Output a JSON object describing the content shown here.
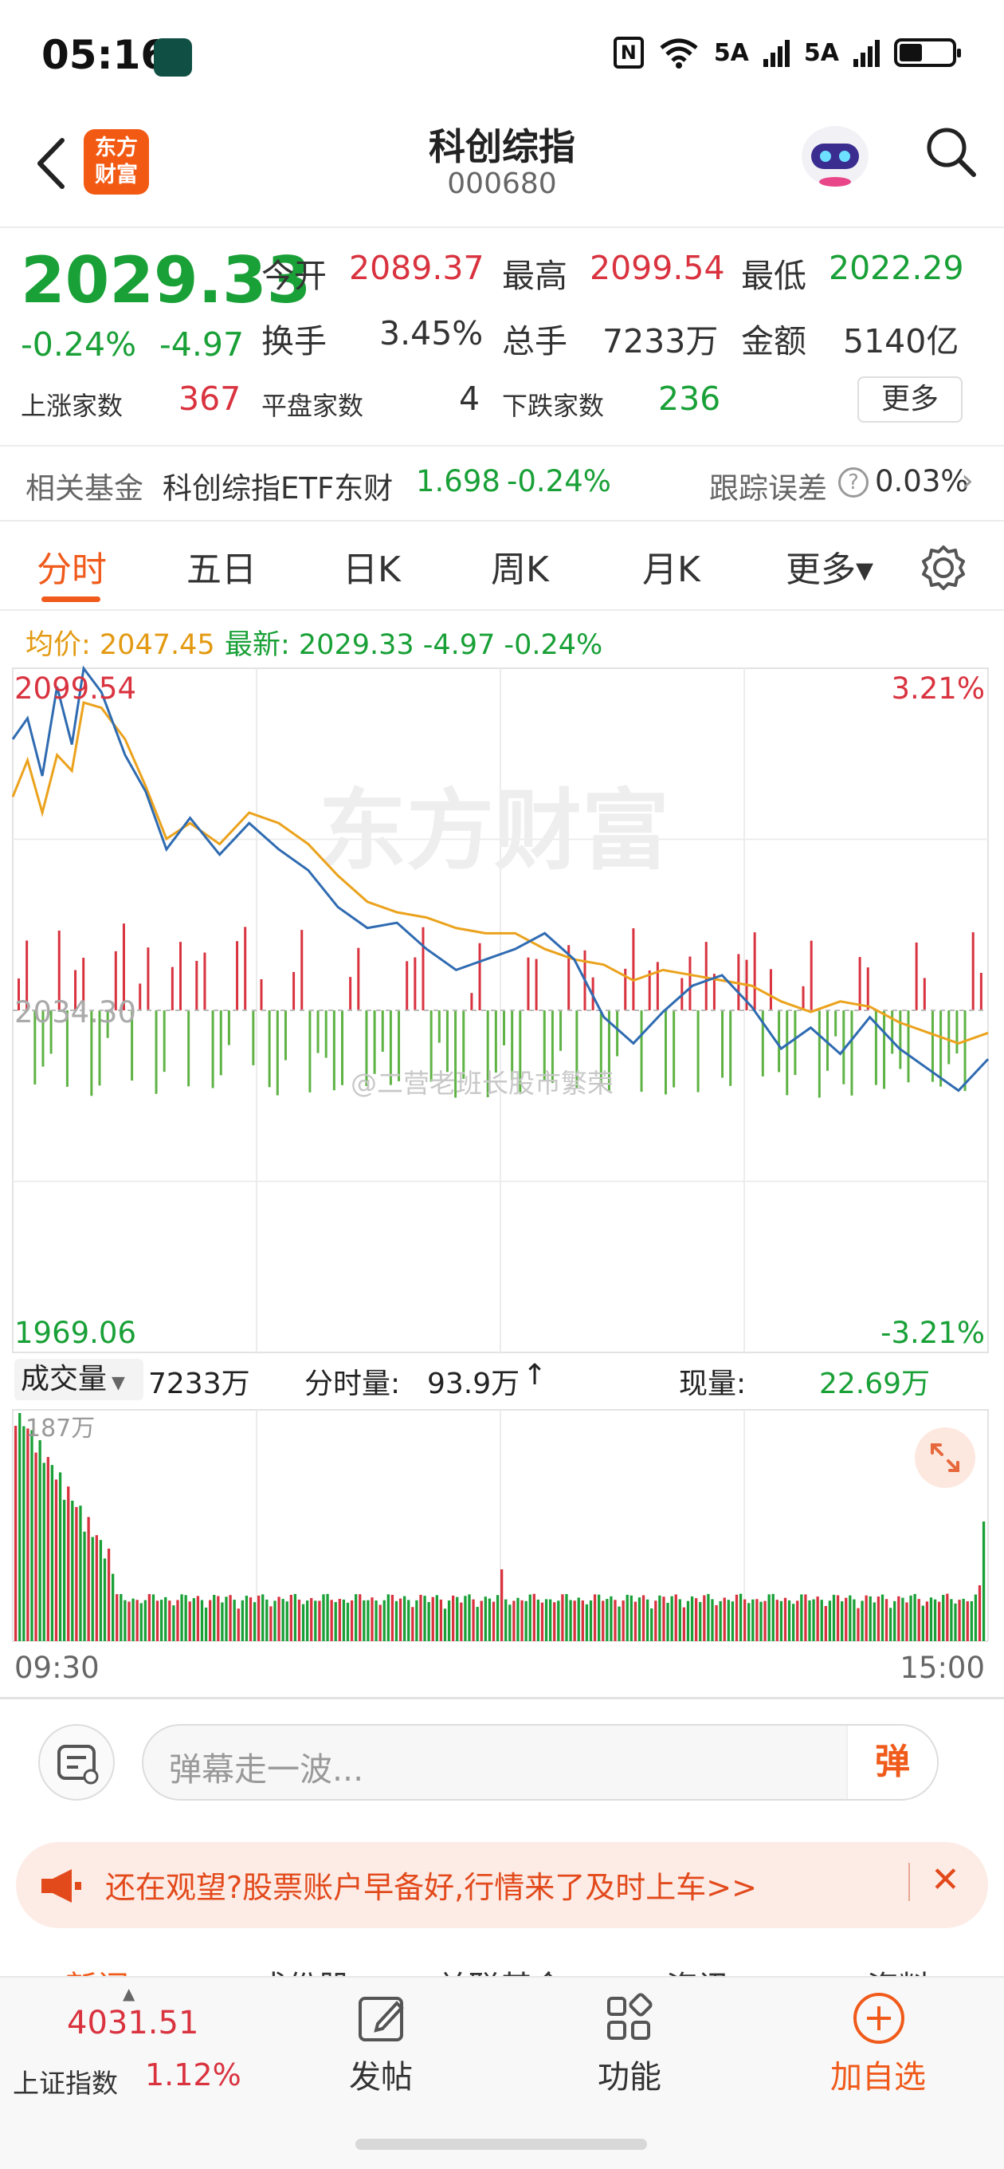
{
  "status_bar": {
    "time": "05:16",
    "net1": "5A",
    "net2": "5A"
  },
  "header": {
    "brand": "东方财富",
    "brand_line1": "东方",
    "brand_line2": "财富",
    "title": "科创综指",
    "code": "000680"
  },
  "quote": {
    "price": "2029.33",
    "change_pct": "-0.24%",
    "change": "-4.97",
    "open_label": "今开",
    "open": "2089.37",
    "high_label": "最高",
    "high": "2099.54",
    "low_label": "最低",
    "low": "2022.29",
    "turnover_label": "换手",
    "turnover": "3.45%",
    "volume_label": "总手",
    "volume": "7233万",
    "amount_label": "金额",
    "amount": "5140亿",
    "up_label": "上涨家数",
    "up": "367",
    "flat_label": "平盘家数",
    "flat": "4",
    "down_label": "下跌家数",
    "down": "236",
    "more": "更多"
  },
  "fund": {
    "label": "相关基金",
    "name": "科创综指ETF东财",
    "price": "1.698",
    "change": "-0.24%",
    "tracking_label": "跟踪误差",
    "tracking_value": "0.03%"
  },
  "tabs": [
    {
      "label": "分时",
      "active": true
    },
    {
      "label": "五日"
    },
    {
      "label": "日K"
    },
    {
      "label": "周K"
    },
    {
      "label": "月K"
    },
    {
      "label": "更多▾"
    }
  ],
  "chart_info": {
    "avg_label": "均价: 2047.45",
    "latest_label": "最新: 2029.33 -4.97 -0.24%"
  },
  "chart_labels": {
    "top_left": "2099.54",
    "top_right": "3.21%",
    "mid_left": "2034.30",
    "bottom_left": "1969.06",
    "bottom_right": "-3.21%",
    "vol_max": "187万",
    "time_start": "09:30",
    "time_end": "15:00",
    "watermark": "东方财富",
    "credit": "@二营老班长股市繁荣"
  },
  "volume_header": {
    "select": "成交量",
    "total": "7233万",
    "minute_label": "分时量:",
    "minute_value": "93.9万",
    "minute_arrow": "↑",
    "current_label": "现量:",
    "current_value": "22.69万"
  },
  "danmaku": {
    "placeholder": "弹幕走一波...",
    "send": "弹"
  },
  "promo": {
    "text": "还在观望?股票账户早备好,行情来了及时上车>>",
    "close": "✕"
  },
  "subtabs": [
    "新闻",
    "成份股",
    "关联基金",
    "资讯",
    "资料"
  ],
  "bottom_bar": {
    "index_value": "4031.51",
    "index_name": "上证指数",
    "index_change": "1.12%",
    "post": "发帖",
    "function": "功能",
    "add_watch": "加自选"
  },
  "colors": {
    "up": "#d9333f",
    "down": "#19a037",
    "price_line": "#2f6bb1",
    "avg_line": "#eba21c",
    "accent": "#f05a1a"
  },
  "chart_data": {
    "type": "line",
    "x_range": [
      "09:30",
      "15:00"
    ],
    "ylim": [
      1969.06,
      2099.54
    ],
    "reference": 2034.3,
    "pct_range": [
      "-3.21%",
      "3.21%"
    ],
    "series": [
      {
        "name": "最新",
        "color": "#2f6bb1",
        "x_min": [
          0,
          5,
          10,
          15,
          20,
          24,
          30,
          38,
          45,
          52,
          60,
          70,
          80,
          90,
          100,
          110,
          120,
          130,
          140,
          150,
          160,
          170,
          180,
          190,
          200,
          210,
          220,
          230,
          240,
          250,
          260,
          270,
          280,
          290,
          300,
          310,
          320,
          330
        ],
        "values": [
          2086,
          2090,
          2079,
          2096,
          2085,
          2099.5,
          2095,
          2083,
          2076,
          2065,
          2071,
          2064,
          2070,
          2065,
          2061,
          2054,
          2050,
          2051,
          2046,
          2042,
          2044,
          2046,
          2049,
          2044,
          2033,
          2028,
          2034,
          2039,
          2041,
          2035,
          2027,
          2031,
          2026,
          2033,
          2027,
          2023,
          2019,
          2025,
          2024
        ]
      },
      {
        "name": "均价",
        "color": "#eba21c",
        "x_min": [
          0,
          5,
          10,
          15,
          20,
          24,
          30,
          38,
          45,
          52,
          60,
          70,
          80,
          90,
          100,
          110,
          120,
          130,
          140,
          150,
          160,
          170,
          180,
          190,
          200,
          210,
          220,
          230,
          240,
          250,
          260,
          270,
          280,
          290,
          300,
          310,
          320,
          330
        ],
        "values": [
          2075,
          2082,
          2072,
          2083,
          2080,
          2093,
          2092,
          2086,
          2077,
          2067,
          2070,
          2066,
          2072,
          2070,
          2066,
          2060,
          2055,
          2053,
          2052,
          2050,
          2049,
          2049,
          2046,
          2044,
          2043,
          2040,
          2042,
          2041,
          2040,
          2039,
          2036,
          2034,
          2036,
          2035,
          2032,
          2030,
          2028,
          2030,
          2031
        ]
      }
    ]
  }
}
